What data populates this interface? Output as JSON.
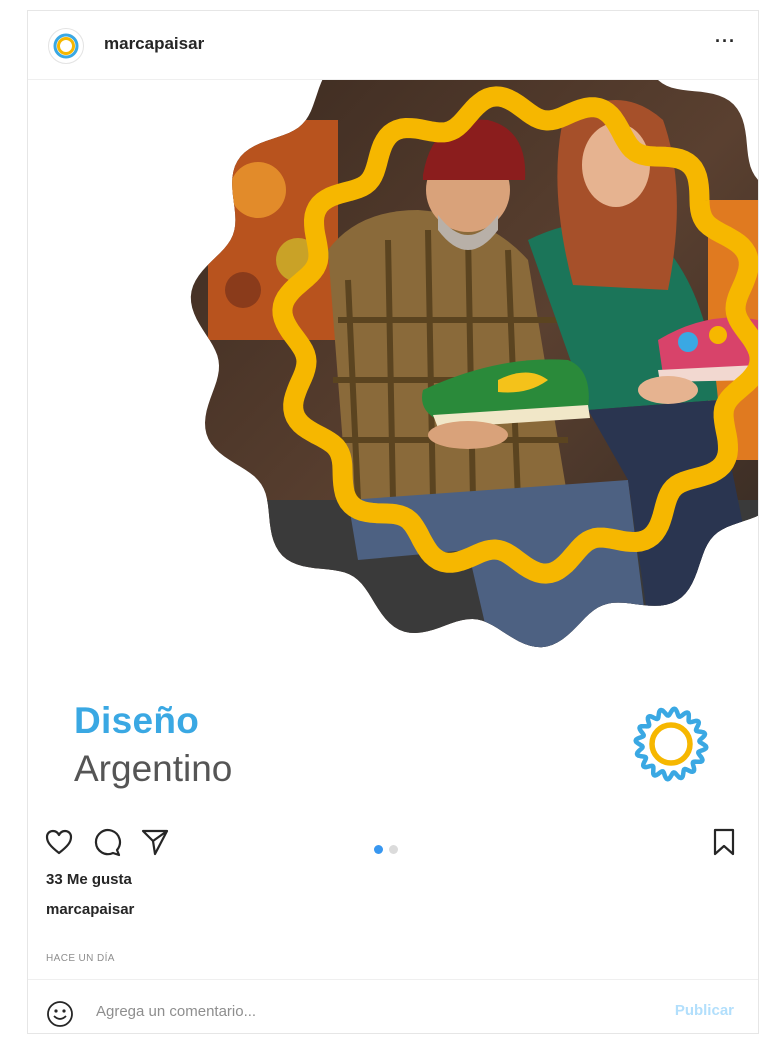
{
  "header": {
    "username": "marcapaisar",
    "more_label": "···",
    "avatar_icon": "sun-logo-icon"
  },
  "post": {
    "brand_title_bold": "Diseño",
    "brand_title_light": "Argentino",
    "brand_logo_icon": "sun-logo-icon",
    "photo_subject": "two-people-holding-sneakers",
    "carousel": {
      "total": 2,
      "active": 1
    }
  },
  "actions": {
    "like_icon": "heart-icon",
    "comment_icon": "comment-icon",
    "share_icon": "paper-plane-icon",
    "save_icon": "bookmark-icon"
  },
  "likes_text": "33 Me gusta",
  "caption_user": "marcapaisar",
  "timestamp": "HACE UN DÍA",
  "comment": {
    "emoji_icon": "emoji-icon",
    "placeholder": "Agrega un comentario...",
    "publish_label": "Publicar"
  },
  "colors": {
    "brand_blue": "#3aa8e3",
    "sun_yellow": "#f6b700",
    "dot_active": "#3897f0",
    "dot_inactive": "#dbdbdb",
    "publish_disabled": "#b2dffc"
  }
}
